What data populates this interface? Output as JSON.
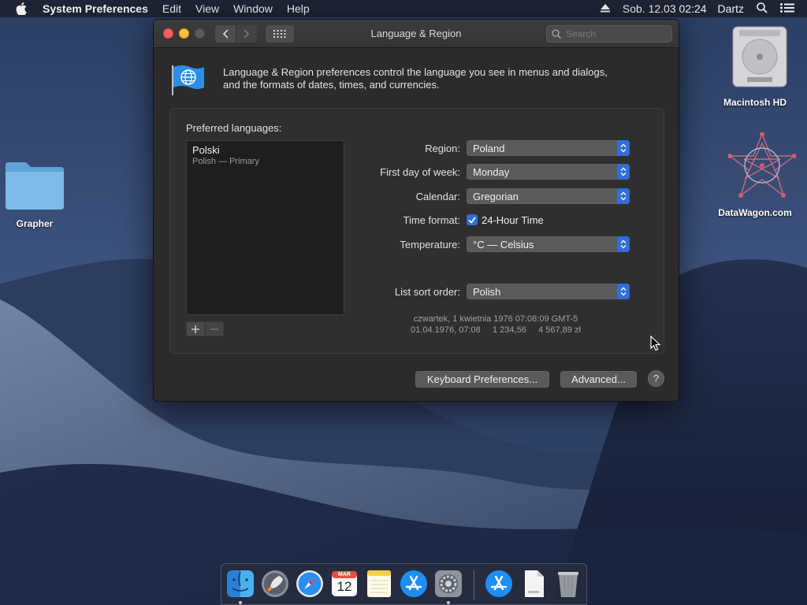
{
  "menubar": {
    "app_name": "System Preferences",
    "menus": [
      "Edit",
      "View",
      "Window",
      "Help"
    ],
    "clock": "Sob. 12.03  02:24",
    "user": "Dartz"
  },
  "desktop": {
    "icons": {
      "grapher": "Grapher",
      "macintosh_hd": "Macintosh HD",
      "datawagon": "DataWagon.com"
    }
  },
  "window": {
    "title": "Language & Region",
    "search_placeholder": "Search",
    "intro_line1": "Language & Region preferences control the language you see in menus and dialogs,",
    "intro_line2": "and the formats of dates, times, and currencies.",
    "preferred_languages_label": "Preferred languages:",
    "languages": [
      {
        "name": "Polski",
        "sub": "Polish — Primary"
      }
    ],
    "settings": {
      "region": {
        "label": "Region:",
        "value": "Poland"
      },
      "first_day": {
        "label": "First day of week:",
        "value": "Monday"
      },
      "calendar": {
        "label": "Calendar:",
        "value": "Gregorian"
      },
      "time_format": {
        "label": "Time format:",
        "value": "24-Hour Time",
        "checked": true
      },
      "temperature": {
        "label": "Temperature:",
        "value": "°C — Celsius"
      },
      "list_sort": {
        "label": "List sort order:",
        "value": "Polish"
      }
    },
    "sample_line1": "czwartek, 1 kwietnia 1976 07:08:09 GMT-5",
    "sample_line2": "01.04.1976, 07:08     1 234,56     4 567,89 zł",
    "keyboard_prefs_button": "Keyboard Preferences...",
    "advanced_button": "Advanced...",
    "help_button": "?"
  },
  "dock": {
    "calendar_month": "MAR",
    "calendar_day": "12"
  },
  "colors": {
    "accent": "#2f6fd6",
    "window_bg": "#2b2b2b",
    "close": "#fc605c",
    "minimize": "#fdbc40"
  }
}
